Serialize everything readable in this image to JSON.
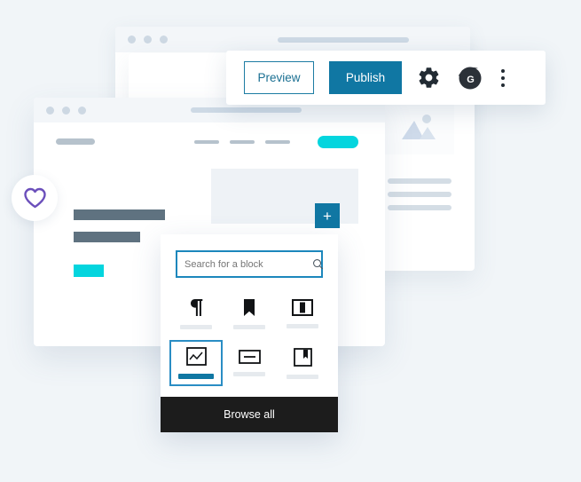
{
  "page": {
    "background_color": "#f1f5f8",
    "accent_blue": "#1077a3",
    "accent_cyan": "#04d5de",
    "heart_purple": "#6b4fbb",
    "dark_bar": "#5f7280"
  },
  "windows": {
    "back": {
      "name": "background-browser-window",
      "dots": [
        "dot-1",
        "dot-2",
        "dot-3"
      ]
    },
    "middle": {
      "name": "middle-browser-window",
      "image_placeholder_icon": "image-placeholder-icon",
      "text_lines": 3
    },
    "front": {
      "name": "editor-browser-window",
      "dots": [
        "dot-1",
        "dot-2",
        "dot-3"
      ],
      "nav_links": 3
    }
  },
  "toolbar": {
    "preview_label": "Preview",
    "publish_label": "Publish",
    "settings_icon": "gear-icon",
    "avatar_icon": "gravatar-avatar-icon",
    "avatar_letter": "G",
    "more_icon": "kebab-menu-icon"
  },
  "add_block": {
    "label": "+",
    "name": "add-block-button"
  },
  "heart_badge": {
    "icon": "heart-icon"
  },
  "inserter": {
    "search": {
      "placeholder": "Search for a block",
      "value": "",
      "icon": "search-icon"
    },
    "blocks": [
      {
        "icon": "paragraph-icon",
        "glyph": "¶",
        "selected": false
      },
      {
        "icon": "heading-bookmark-icon",
        "glyph": "bookmark",
        "selected": false
      },
      {
        "icon": "columns-icon",
        "glyph": "columns",
        "selected": false
      },
      {
        "icon": "image-icon",
        "glyph": "image",
        "selected": true
      },
      {
        "icon": "button-icon",
        "glyph": "button",
        "selected": false
      },
      {
        "icon": "framed-bookmark-icon",
        "glyph": "framed-bookmark",
        "selected": false
      }
    ],
    "browse_all_label": "Browse all"
  }
}
